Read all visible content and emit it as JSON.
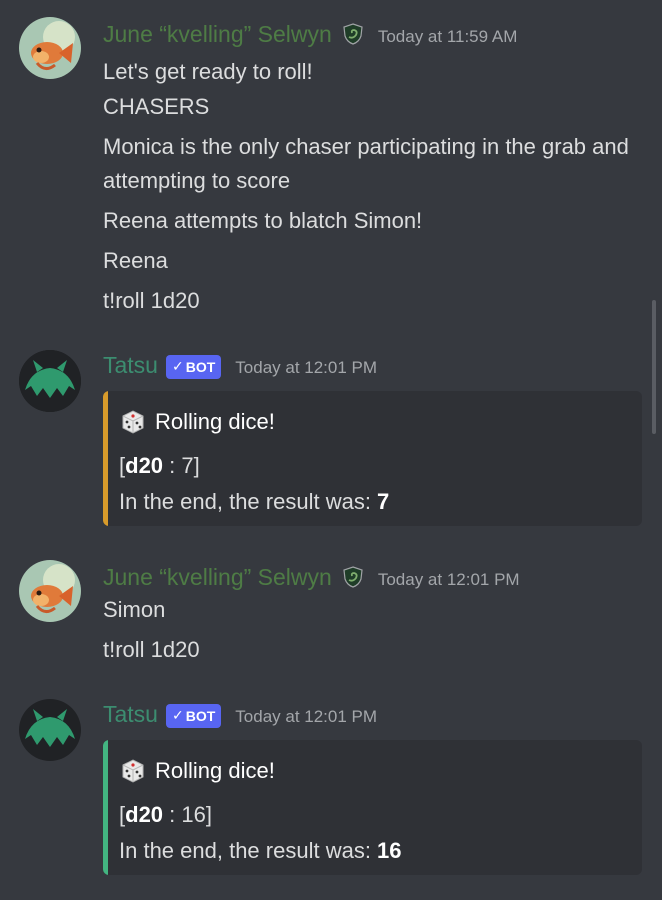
{
  "messages": [
    {
      "author": "June “kvelling” Selwyn",
      "timestamp": "Today at 11:59 AM",
      "lines": [
        "Let's get ready to roll!",
        "CHASERS",
        "Monica is the only chaser participating in the grab and attempting to score",
        "Reena attempts to blatch Simon!",
        "Reena",
        "t!roll 1d20"
      ]
    },
    {
      "author": "Tatsu",
      "badge": "BOT",
      "timestamp": "Today at 12:01 PM",
      "embed": {
        "title": "Rolling dice!",
        "die": "d20",
        "roll": " : 7]",
        "result_prefix": "In the end, the result was: ",
        "result": "7",
        "bar_color": "#d89b2b"
      }
    },
    {
      "author": "June “kvelling” Selwyn",
      "timestamp": "Today at 12:01 PM",
      "lines": [
        "Simon",
        "t!roll 1d20"
      ]
    },
    {
      "author": "Tatsu",
      "badge": "BOT",
      "timestamp": "Today at 12:01 PM",
      "embed": {
        "title": "Rolling dice!",
        "die": "d20",
        "roll": " : 16]",
        "result_prefix": "In the end, the result was: ",
        "result": "16",
        "bar_color": "#43b581"
      }
    }
  ],
  "icons": {
    "june_avatar": "goldfish-avatar-icon",
    "tatsu_avatar": "tatsu-avatar-icon",
    "role": "slytherin-crest-icon",
    "dice": "game-die-icon",
    "badge_check": "checkmark-icon"
  },
  "colors": {
    "background": "#36393f",
    "embed_bg": "#2f3136",
    "june_name": "#4e7c45",
    "tatsu_name": "#3c8d70",
    "bot_badge": "#5865f2"
  }
}
